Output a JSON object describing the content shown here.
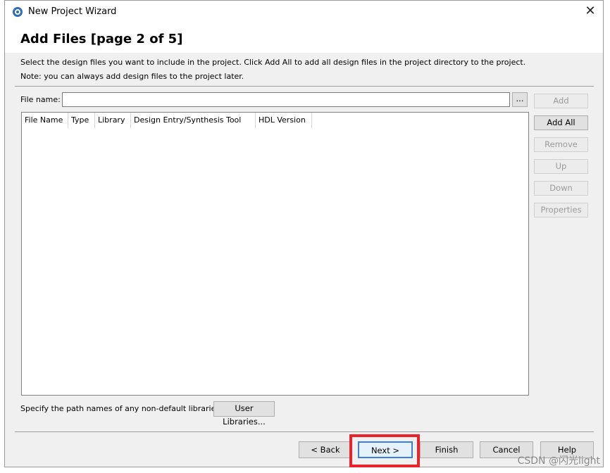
{
  "window": {
    "title": "New Project Wizard",
    "close_glyph": "✕"
  },
  "header": {
    "page_title": "Add Files [page 2 of 5]"
  },
  "description": {
    "line1": "Select the design files you want to include in the project. Click Add All to add all design files in the project directory to the project.",
    "line2": "Note: you can always add design files to the project later."
  },
  "file_name": {
    "label": "File name:",
    "value": "",
    "browse_label": "..."
  },
  "table": {
    "columns": [
      "File Name",
      "Type",
      "Library",
      "Design Entry/Synthesis Tool",
      "HDL Version"
    ],
    "rows": []
  },
  "side_buttons": {
    "add": "Add",
    "add_all": "Add All",
    "remove": "Remove",
    "up": "Up",
    "down": "Down",
    "properties": "Properties"
  },
  "libraries": {
    "label": "Specify the path names of any non-default libraries.",
    "button": "User Libraries..."
  },
  "footer": {
    "back": "< Back",
    "next": "Next >",
    "finish": "Finish",
    "cancel": "Cancel",
    "help": "Help"
  },
  "watermark": "CSDN @闪光light",
  "colors": {
    "highlight": "#e8232a",
    "focus_border": "#3c7fd6"
  }
}
